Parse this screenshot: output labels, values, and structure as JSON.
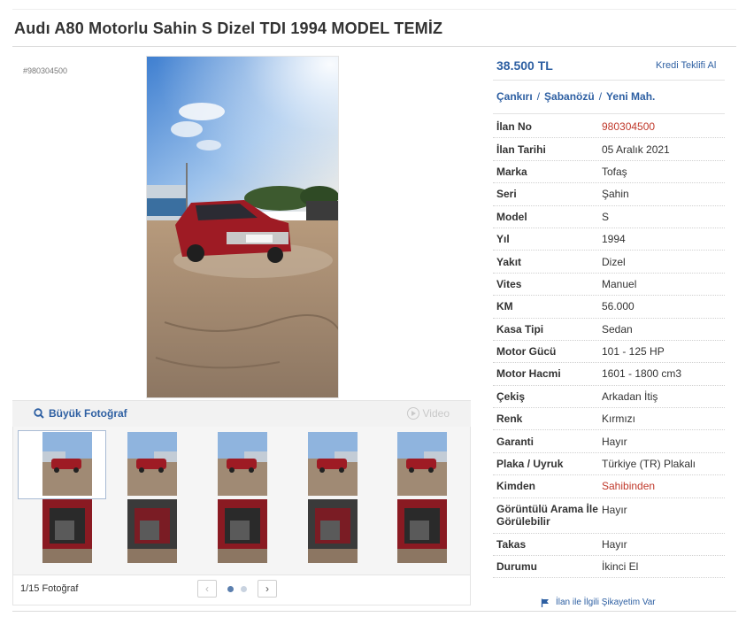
{
  "listing": {
    "title": "Audı A80 Motorlu Sahin S Dizel TDI 1994 MODEL TEMİZ",
    "id_tag": "#980304500",
    "price": "38.500 TL",
    "credit_link": "Kredi Teklifi Al",
    "location": [
      "Çankırı",
      "Şabanözü",
      "Yeni Mah."
    ],
    "location_separator": "/"
  },
  "gallery": {
    "big_photo_label": "Büyük Fotoğraf",
    "video_label": "Video",
    "photo_count": "1/15 Fotoğraf",
    "prev_label": "‹",
    "next_label": "›",
    "page_dots": 2,
    "active_page": 1,
    "thumbnail_count": 10,
    "selected_thumbnail": 1
  },
  "specs": [
    {
      "label": "İlan No",
      "value": "980304500",
      "color": "red"
    },
    {
      "label": "İlan Tarihi",
      "value": "05 Aralık 2021"
    },
    {
      "label": "Marka",
      "value": "Tofaş"
    },
    {
      "label": "Seri",
      "value": "Şahin"
    },
    {
      "label": "Model",
      "value": "S"
    },
    {
      "label": "Yıl",
      "value": "1994"
    },
    {
      "label": "Yakıt",
      "value": "Dizel"
    },
    {
      "label": "Vites",
      "value": "Manuel"
    },
    {
      "label": "KM",
      "value": "56.000"
    },
    {
      "label": "Kasa Tipi",
      "value": "Sedan"
    },
    {
      "label": "Motor Gücü",
      "value": "101 - 125 HP"
    },
    {
      "label": "Motor Hacmi",
      "value": "1601 - 1800 cm3"
    },
    {
      "label": "Çekiş",
      "value": "Arkadan İtiş"
    },
    {
      "label": "Renk",
      "value": "Kırmızı"
    },
    {
      "label": "Garanti",
      "value": "Hayır"
    },
    {
      "label": "Plaka / Uyruk",
      "value": "Türkiye (TR) Plakalı"
    },
    {
      "label": "Kimden",
      "value": "Sahibinden",
      "color": "red"
    },
    {
      "label": "Görüntülü Arama İle Görülebilir",
      "value": "Hayır",
      "tall": true
    },
    {
      "label": "Takas",
      "value": "Hayır"
    },
    {
      "label": "Durumu",
      "value": "İkinci El"
    }
  ],
  "complaint_link": "İlan ile İlgili Şikayetim Var",
  "colors": {
    "link_blue": "#2d5fa2",
    "highlight_red": "#c0392b",
    "car_red": "#9e1b24"
  },
  "icons": {
    "big_photo": "magnifier-icon",
    "video": "play-circle-icon",
    "complaint": "flag-icon"
  }
}
